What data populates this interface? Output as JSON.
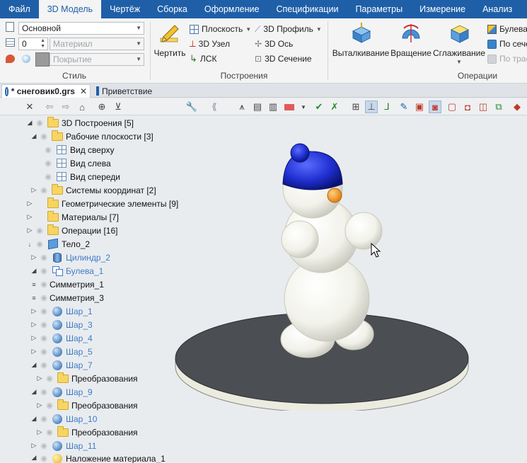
{
  "menubar": {
    "items": [
      "Файл",
      "3D Модель",
      "Чертёж",
      "Сборка",
      "Оформление",
      "Спецификации",
      "Параметры",
      "Измерение",
      "Анализ"
    ],
    "active": "3D Модель"
  },
  "ribbon": {
    "style_group": {
      "label": "Стиль",
      "style_value": "Основной",
      "layer_value": "0",
      "material_placeholder": "Материал",
      "coating_placeholder": "Покрытие"
    },
    "build_group": {
      "label": "Построения",
      "sketch_button": "Чертить",
      "plane": "Плоскость",
      "node_3d": "3D Узел",
      "lcs": "ЛСК",
      "profile_3d": "3D Профиль",
      "axis_3d": "3D Ось",
      "section_3d": "3D Сечение"
    },
    "ops_group": {
      "label": "Операции",
      "extrude": "Выталкивание",
      "rotate": "Вращение",
      "smooth": "Сглаживание",
      "boolean": "Булева",
      "by_sections": "По сече",
      "by_path": "По трае"
    }
  },
  "doctabs": [
    {
      "label": "* снеговик0.grs",
      "active": true
    },
    {
      "label": "Приветствие",
      "active": false
    }
  ],
  "tree": {
    "rows": [
      {
        "label": "3D Построения [5]"
      },
      {
        "label": "Рабочие плоскости [3]"
      },
      {
        "label": "Вид сверху"
      },
      {
        "label": "Вид слева"
      },
      {
        "label": "Вид спереди"
      },
      {
        "label": "Системы координат [2]"
      },
      {
        "label": "Геометрические элементы [9]"
      },
      {
        "label": "Материалы [7]"
      },
      {
        "label": "Операции [16]"
      },
      {
        "label": "Тело_2"
      },
      {
        "label": "Цилиндр_2"
      },
      {
        "label": "Булева_1"
      },
      {
        "label": "Симметрия_1"
      },
      {
        "label": "Симметрия_3"
      },
      {
        "label": "Шар_1"
      },
      {
        "label": "Шар_3"
      },
      {
        "label": "Шар_4"
      },
      {
        "label": "Шар_5"
      },
      {
        "label": "Шар_7"
      },
      {
        "label": "Преобразования"
      },
      {
        "label": "Шар_9"
      },
      {
        "label": "Преобразования"
      },
      {
        "label": "Шар_10"
      },
      {
        "label": "Преобразования"
      },
      {
        "label": "Шар_11"
      },
      {
        "label": "Наложение материала_1"
      }
    ]
  },
  "colors": {
    "menubar": "#1f5fa8",
    "link": "#3f7cc6",
    "snow": "#f2f2ea",
    "hat": "#1f2fd0",
    "nose": "#f09a24",
    "platform_top": "#4b4e52"
  },
  "icons": [
    "close-icon",
    "back-icon",
    "forward-icon",
    "home-icon",
    "target-icon",
    "filter-icon",
    "wrench-icon",
    "collapse-icon"
  ]
}
